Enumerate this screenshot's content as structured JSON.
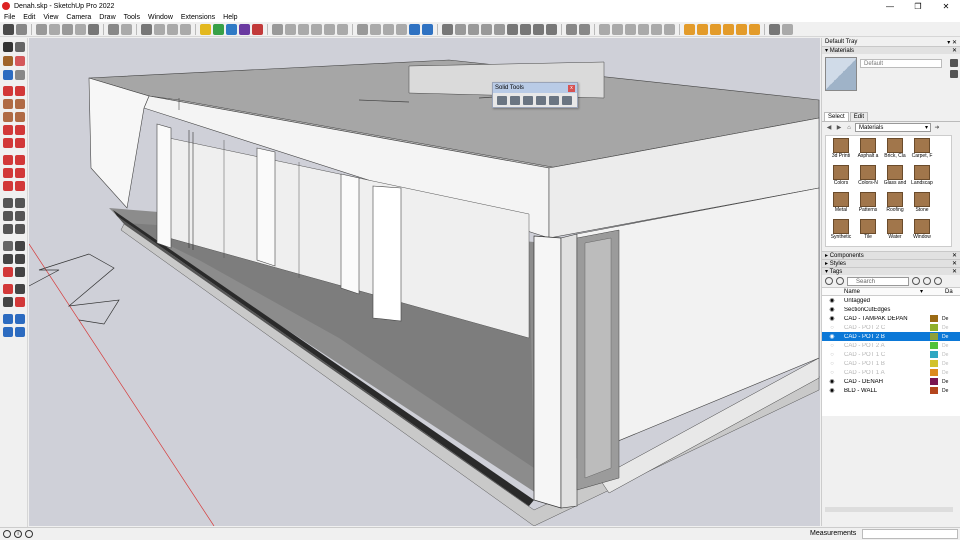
{
  "window": {
    "title": "Denah.skp - SketchUp Pro 2022"
  },
  "menu": [
    "File",
    "Edit",
    "View",
    "Camera",
    "Draw",
    "Tools",
    "Window",
    "Extensions",
    "Help"
  ],
  "solid_tools": {
    "title": "Solid Tools"
  },
  "tray": {
    "title": "Default Tray",
    "materials": {
      "header": "Materials",
      "current_name": "Default",
      "tabs": [
        "Select",
        "Edit"
      ],
      "library": "Materials",
      "items": [
        "3d Printi",
        "Asphalt a",
        "Brick, Cla",
        "Carpet, F",
        "Colors",
        "Colors-N",
        "Glass and",
        "Landscap",
        "Metal",
        "Patterns",
        "Roofing",
        "Stone",
        "Synthetic",
        "Tile",
        "Water",
        "Window"
      ]
    },
    "components": "Components",
    "styles": "Styles",
    "tags": {
      "header": "Tags",
      "search_placeholder": "Search",
      "name_col": "Name",
      "dash_col": "Da",
      "rows": [
        {
          "name": "Untagged",
          "visible": true,
          "color": "",
          "dash": ""
        },
        {
          "name": "SectionCutEdges",
          "visible": true,
          "color": "",
          "dash": ""
        },
        {
          "name": "CAD - TAMPAK DEPAN",
          "visible": true,
          "color": "#9a6a14",
          "dash": "De"
        },
        {
          "name": "CAD - POT 2 C",
          "visible": false,
          "color": "#8fb02a",
          "dash": "De"
        },
        {
          "name": "CAD - POT 2 B",
          "visible": true,
          "color": "#8ea03a",
          "dash": "De",
          "selected": true
        },
        {
          "name": "CAD - POT 2 A",
          "visible": false,
          "color": "#52c23a",
          "dash": "De"
        },
        {
          "name": "CAD - POT 1 C",
          "visible": false,
          "color": "#2fa7c2",
          "dash": "De"
        },
        {
          "name": "CAD - POT 1 B",
          "visible": false,
          "color": "#d2c22a",
          "dash": "De"
        },
        {
          "name": "CAD - POT 1 A",
          "visible": false,
          "color": "#dc8a1e",
          "dash": "De"
        },
        {
          "name": "CAD - DENAH",
          "visible": true,
          "color": "#7a1550",
          "dash": "De"
        },
        {
          "name": "BLD - WALL",
          "visible": true,
          "color": "#b4451d",
          "dash": "De"
        }
      ]
    }
  },
  "status": {
    "measurements_label": "Measurements"
  }
}
